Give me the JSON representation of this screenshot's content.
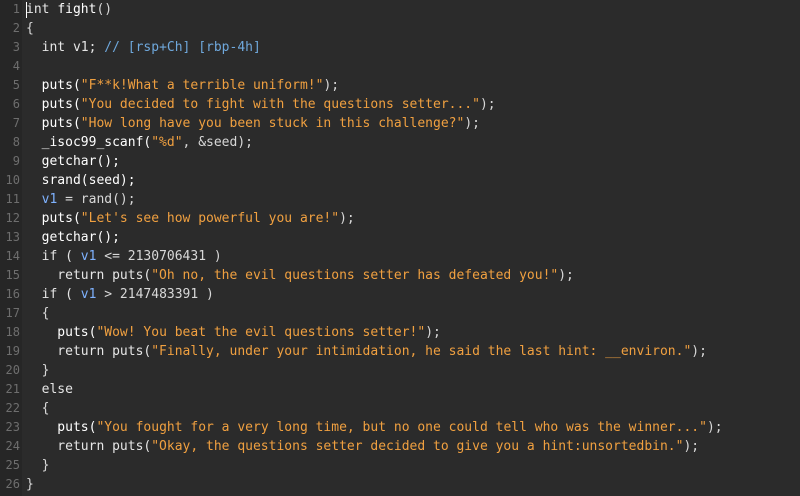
{
  "editor": {
    "lines": [
      {
        "n": "1",
        "segs": [
          {
            "t": "int ",
            "c": "kw"
          },
          {
            "t": "fight",
            "c": "fn"
          },
          {
            "t": "()",
            "c": "plain"
          }
        ]
      },
      {
        "n": "2",
        "segs": [
          {
            "t": "{",
            "c": "plain"
          }
        ]
      },
      {
        "n": "3",
        "segs": [
          {
            "t": "  int v1; ",
            "c": "kw"
          },
          {
            "t": "// [rsp+Ch] [rbp-4h]",
            "c": "com"
          }
        ]
      },
      {
        "n": "4",
        "segs": []
      },
      {
        "n": "5",
        "segs": [
          {
            "t": "  puts(",
            "c": "fn"
          },
          {
            "t": "\"F**k!What a terrible uniform!\"",
            "c": "str"
          },
          {
            "t": ");",
            "c": "plain"
          }
        ]
      },
      {
        "n": "6",
        "segs": [
          {
            "t": "  puts(",
            "c": "fn"
          },
          {
            "t": "\"You decided to fight with the questions setter...\"",
            "c": "str"
          },
          {
            "t": ");",
            "c": "plain"
          }
        ]
      },
      {
        "n": "7",
        "segs": [
          {
            "t": "  puts(",
            "c": "fn"
          },
          {
            "t": "\"How long have you been stuck in this challenge?\"",
            "c": "str"
          },
          {
            "t": ");",
            "c": "plain"
          }
        ]
      },
      {
        "n": "8",
        "segs": [
          {
            "t": "  _isoc99_scanf(",
            "c": "fn"
          },
          {
            "t": "\"%d\"",
            "c": "str"
          },
          {
            "t": ", &seed);",
            "c": "plain"
          }
        ]
      },
      {
        "n": "9",
        "segs": [
          {
            "t": "  getchar();",
            "c": "fn"
          }
        ]
      },
      {
        "n": "10",
        "segs": [
          {
            "t": "  srand(seed);",
            "c": "fn"
          }
        ]
      },
      {
        "n": "11",
        "segs": [
          {
            "t": "  ",
            "c": "plain"
          },
          {
            "t": "v1",
            "c": "var"
          },
          {
            "t": " = rand();",
            "c": "plain"
          }
        ]
      },
      {
        "n": "12",
        "segs": [
          {
            "t": "  puts(",
            "c": "fn"
          },
          {
            "t": "\"Let's see how powerful you are!\"",
            "c": "str"
          },
          {
            "t": ");",
            "c": "plain"
          }
        ]
      },
      {
        "n": "13",
        "segs": [
          {
            "t": "  getchar();",
            "c": "fn"
          }
        ]
      },
      {
        "n": "14",
        "segs": [
          {
            "t": "  if ( ",
            "c": "kw"
          },
          {
            "t": "v1",
            "c": "var"
          },
          {
            "t": " <= 2130706431 )",
            "c": "plain"
          }
        ]
      },
      {
        "n": "15",
        "segs": [
          {
            "t": "    return puts(",
            "c": "kw"
          },
          {
            "t": "\"Oh no, the evil questions setter has defeated you!\"",
            "c": "str"
          },
          {
            "t": ");",
            "c": "plain"
          }
        ]
      },
      {
        "n": "16",
        "segs": [
          {
            "t": "  if ( ",
            "c": "kw"
          },
          {
            "t": "v1",
            "c": "var"
          },
          {
            "t": " > 2147483391 )",
            "c": "plain"
          }
        ]
      },
      {
        "n": "17",
        "segs": [
          {
            "t": "  {",
            "c": "plain"
          }
        ]
      },
      {
        "n": "18",
        "segs": [
          {
            "t": "    puts(",
            "c": "fn"
          },
          {
            "t": "\"Wow! You beat the evil questions setter!\"",
            "c": "str"
          },
          {
            "t": ");",
            "c": "plain"
          }
        ]
      },
      {
        "n": "19",
        "segs": [
          {
            "t": "    return puts(",
            "c": "kw"
          },
          {
            "t": "\"Finally, under your intimidation, he said the last hint: __environ.\"",
            "c": "str"
          },
          {
            "t": ");",
            "c": "plain"
          }
        ]
      },
      {
        "n": "20",
        "segs": [
          {
            "t": "  }",
            "c": "plain"
          }
        ]
      },
      {
        "n": "21",
        "segs": [
          {
            "t": "  else",
            "c": "kw"
          }
        ]
      },
      {
        "n": "22",
        "segs": [
          {
            "t": "  {",
            "c": "plain"
          }
        ]
      },
      {
        "n": "23",
        "segs": [
          {
            "t": "    puts(",
            "c": "fn"
          },
          {
            "t": "\"You fought for a very long time, but no one could tell who was the winner...\"",
            "c": "str"
          },
          {
            "t": ");",
            "c": "plain"
          }
        ]
      },
      {
        "n": "24",
        "segs": [
          {
            "t": "    return puts(",
            "c": "kw"
          },
          {
            "t": "\"Okay, the questions setter decided to give you a hint:unsortedbin.\"",
            "c": "str"
          },
          {
            "t": ");",
            "c": "plain"
          }
        ]
      },
      {
        "n": "25",
        "segs": [
          {
            "t": "  }",
            "c": "plain"
          }
        ]
      },
      {
        "n": "26",
        "segs": [
          {
            "t": "}",
            "c": "plain"
          }
        ]
      }
    ]
  },
  "colors": {
    "background": "#2b2b2b",
    "string": "#f0a040",
    "comment": "#6fa8dc",
    "variable": "#7fb2ff",
    "text": "#d8d8d8"
  }
}
